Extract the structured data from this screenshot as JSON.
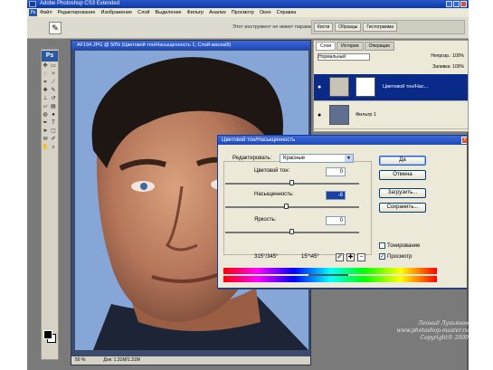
{
  "window": {
    "title": "Adobe Photoshop CS3 Extended"
  },
  "menu": [
    "Файл",
    "Редактирование",
    "Изображение",
    "Слой",
    "Выделение",
    "Фильтр",
    "Анализ",
    "Просмотр",
    "Окно",
    "Справка"
  ],
  "optionsbar": {
    "hint": "Этот инструмент не имеет параметров.",
    "dock_tabs": [
      "Кисти",
      "Образцы",
      "Гистограмма"
    ]
  },
  "toolbox": {
    "logo": "Ps"
  },
  "document": {
    "title": "AF194.JPG @ 50% (Цветовой тон/Насыщенность 1, Слой-маска/8)",
    "zoom": "50 %",
    "doc_info": "Док: 1.31M/1.31M"
  },
  "layers": {
    "tabs": [
      "Слои",
      "История",
      "Операции"
    ],
    "blend_label": "Нормальный",
    "opacity_label": "Непрозр.: 100%",
    "fill_label": "Заливка: 100%",
    "rows": [
      {
        "name": "Цветовой тон/Нас...",
        "selected": true
      },
      {
        "name": "Фильтр 1",
        "selected": false
      }
    ]
  },
  "dialog": {
    "title": "Цветовой тон/Насыщенность",
    "edit_label": "Редактировать:",
    "edit_value": "Красные",
    "params": [
      {
        "label": "Цветовой тон:",
        "value": "0",
        "thumb": 0.5
      },
      {
        "label": "Насыщенность:",
        "value": "-8",
        "thumb": 0.46,
        "highlight": true
      },
      {
        "label": "Яркость:",
        "value": "0",
        "thumb": 0.5
      }
    ],
    "buttons": {
      "ok": "Да",
      "cancel": "Отмена",
      "load": "Загрузить...",
      "save": "Сохранить..."
    },
    "checkboxes": {
      "colorize": {
        "label": "Тонирование",
        "checked": false
      },
      "preview": {
        "label": "Просмотр",
        "checked": true
      }
    },
    "range_left": "315°/345°",
    "range_right": "15°\\45°"
  },
  "watermark": {
    "line1": "Леонид Лукьянов",
    "line2": "www.photoshop-master.ru",
    "line3": "Copyright© 2009"
  }
}
